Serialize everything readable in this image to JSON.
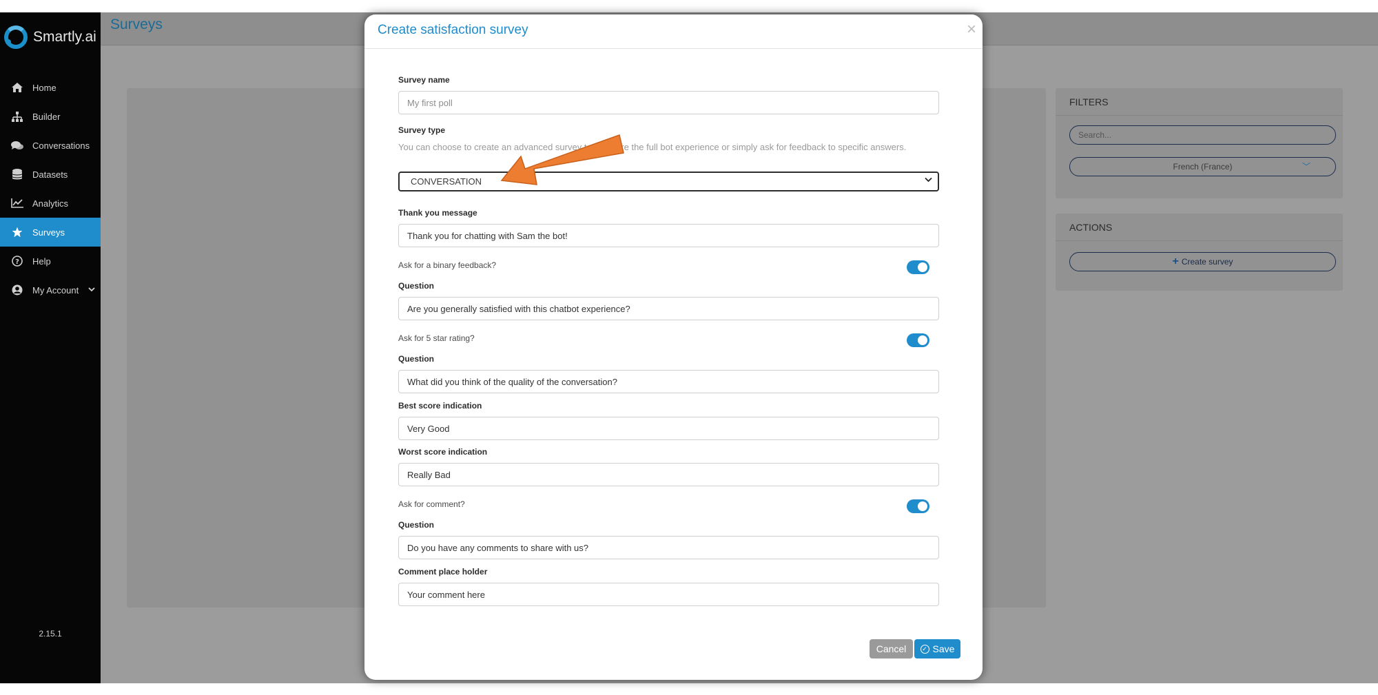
{
  "sidebar": {
    "brand": "Smartly.ai",
    "items": [
      {
        "label": "Home",
        "icon": "home-icon"
      },
      {
        "label": "Builder",
        "icon": "sitemap-icon"
      },
      {
        "label": "Conversations",
        "icon": "comments-icon"
      },
      {
        "label": "Datasets",
        "icon": "database-icon"
      },
      {
        "label": "Analytics",
        "icon": "line-chart-icon"
      },
      {
        "label": "Surveys",
        "icon": "star-icon",
        "active": true
      },
      {
        "label": "Help",
        "icon": "question-circle-icon"
      },
      {
        "label": "My Account",
        "icon": "user-circle-icon",
        "caret": "chevron-down-icon"
      }
    ],
    "version": "2.15.1"
  },
  "header": {
    "title": "Surveys"
  },
  "filters": {
    "title": "FILTERS",
    "search_placeholder": "Search...",
    "language": "French (France)"
  },
  "actions": {
    "title": "ACTIONS",
    "create_label": "Create survey"
  },
  "modal": {
    "title": "Create satisfaction survey",
    "close": "×",
    "survey_name": {
      "label": "Survey name",
      "placeholder": "My first poll"
    },
    "survey_type": {
      "label": "Survey type",
      "description": "You can choose to create an advanced survey to measure the full bot experience or simply ask for feedback to specific answers.",
      "value": "CONVERSATION"
    },
    "thank_you": {
      "label": "Thank you message",
      "value": "Thank you for chatting with Sam the bot!"
    },
    "binary": {
      "toggle_label": "Ask for a binary feedback?",
      "enabled": true,
      "question_label": "Question",
      "question": "Are you generally satisfied with this chatbot experience?"
    },
    "star": {
      "toggle_label": "Ask for 5 star rating?",
      "enabled": true,
      "question_label": "Question",
      "question": "What did you think of the quality of the conversation?",
      "best_label": "Best score indication",
      "best": "Very Good",
      "worst_label": "Worst score indication",
      "worst": "Really Bad"
    },
    "comment": {
      "toggle_label": "Ask for comment?",
      "enabled": true,
      "question_label": "Question",
      "question": "Do you have any comments to share with us?",
      "placeholder_label": "Comment place holder",
      "placeholder": "Your comment here"
    },
    "cancel_label": "Cancel",
    "save_label": "Save"
  },
  "colors": {
    "accent": "#1f8ccc",
    "sidebar_bg": "#060606",
    "annotation_arrow": "#ed7d31"
  }
}
